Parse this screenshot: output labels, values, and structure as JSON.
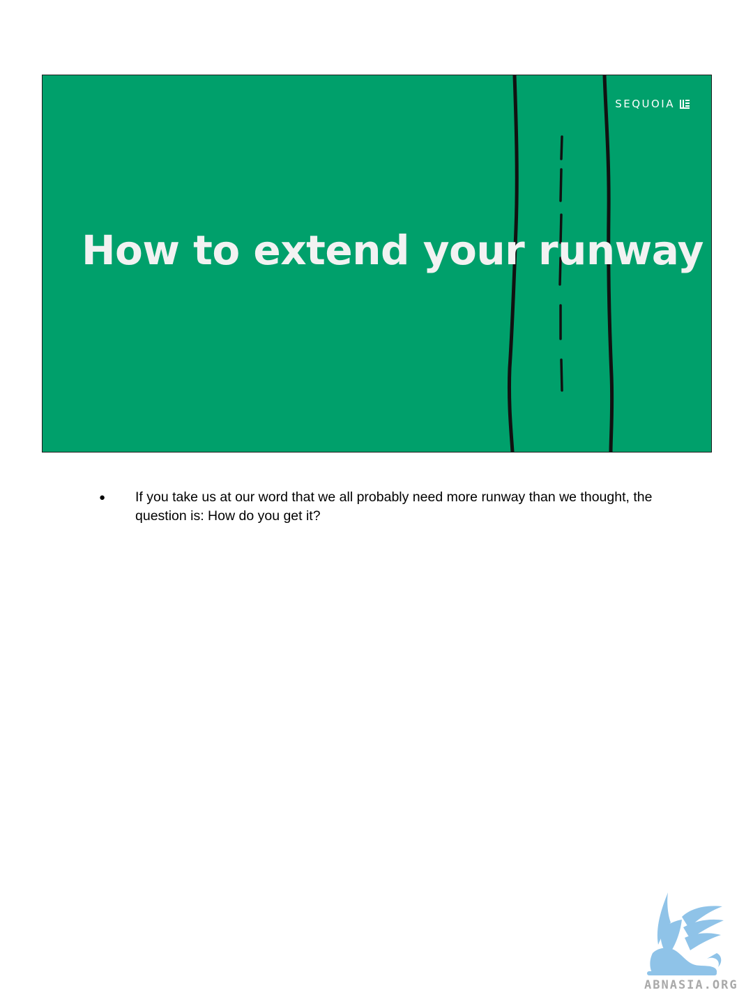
{
  "slide": {
    "brand_name": "SEQUOIA",
    "brand_mark_icon": "sequoia-tree-mark-icon",
    "title": "How to extend your runway",
    "background_color": "#00a06b",
    "road_icon": "runway-road-illustration"
  },
  "notes": {
    "items": [
      {
        "bullet": "●",
        "text": "If you take us at our word that we all probably need more runway than we thought, the question is: How do you get it?"
      }
    ]
  },
  "watermark": {
    "text": "ABNASIA.ORG",
    "icon": "griffin-logo-icon",
    "color": "#8fc3e8"
  }
}
